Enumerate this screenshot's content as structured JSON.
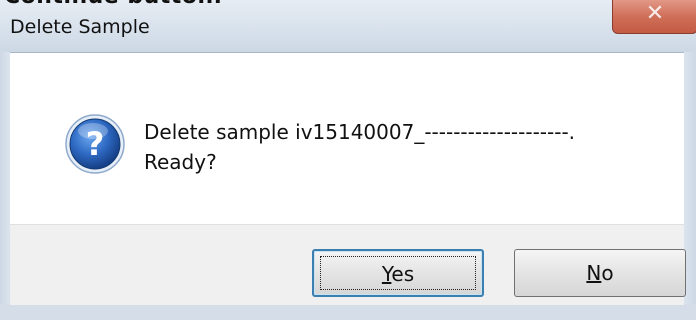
{
  "page": {
    "cropped_caption": "Continue  button."
  },
  "dialog": {
    "title": "Delete Sample",
    "close_glyph": "✕",
    "message_line1": "Delete sample iv15140007_--------------------.",
    "message_line2": "Ready?",
    "icon": "question-icon",
    "buttons": {
      "yes_label": "Yes",
      "no_label": "No"
    }
  },
  "colors": {
    "title_bar": "#d7e1ec",
    "close_button": "#d0705a",
    "icon_blue": "#1e4f9c",
    "button_face": "#e4e4e4",
    "default_button_border": "#3c7fb1"
  }
}
